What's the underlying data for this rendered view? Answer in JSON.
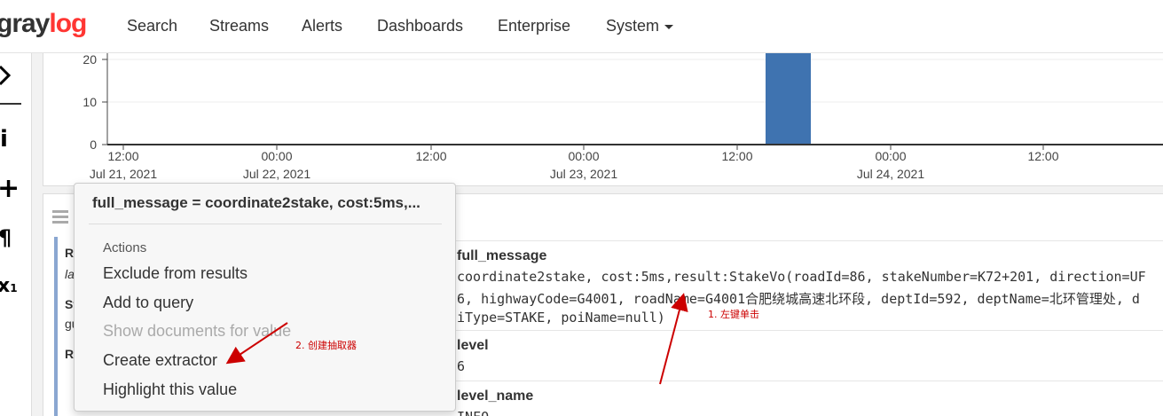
{
  "navbar": {
    "logo_part1": "gray",
    "logo_part2": "log",
    "items": [
      "Search",
      "Streams",
      "Alerts",
      "Dashboards",
      "Enterprise",
      "System"
    ]
  },
  "sidebar": {
    "icons": [
      "chevron-right-icon",
      "info-icon",
      "plus-icon",
      "pilcrow-icon",
      "subscript-x-icon"
    ]
  },
  "histogram": {
    "y_ticks": [
      "20",
      "10",
      "0"
    ],
    "x_ticks": [
      {
        "time": "12:00",
        "date": "Jul 21, 2021"
      },
      {
        "time": "00:00",
        "date": "Jul 22, 2021"
      },
      {
        "time": "12:00",
        "date": ""
      },
      {
        "time": "00:00",
        "date": "Jul 23, 2021"
      },
      {
        "time": "12:00",
        "date": ""
      },
      {
        "time": "00:00",
        "date": "Jul 24, 2021"
      },
      {
        "time": "12:00",
        "date": ""
      }
    ],
    "bar_color": "#3f73b0"
  },
  "chart_data": {
    "type": "bar",
    "categories": [
      "Jul 23, 2021 ~15:00"
    ],
    "values": [
      24
    ],
    "xlabel": "",
    "ylabel": "",
    "ylim": [
      0,
      24
    ]
  },
  "messages": {
    "left_fields": [
      "Re",
      "la",
      "St",
      "gu",
      "Re"
    ],
    "fields": [
      {
        "name": "full_message",
        "lines": [
          "coordinate2stake, cost:5ms,result:StakeVo(roadId=86, stakeNumber=K72+201, direction=UF",
          "6, highwayCode=G4001, roadName=G4001合肥绕城高速北环段, deptId=592, deptName=北环管理处, d",
          "iType=STAKE, poiName=null)"
        ]
      },
      {
        "name": "level",
        "lines": [
          "6"
        ]
      },
      {
        "name": "level_name",
        "lines": [
          "INFO"
        ]
      }
    ]
  },
  "popover": {
    "title": "full_message = coordinate2stake, cost:5ms,...",
    "header": "Actions",
    "items": [
      {
        "label": "Exclude from results",
        "disabled": false
      },
      {
        "label": "Add to query",
        "disabled": false
      },
      {
        "label": "Show documents for value",
        "disabled": true
      },
      {
        "label": "Create extractor",
        "disabled": false
      },
      {
        "label": "Highlight this value",
        "disabled": false
      }
    ]
  },
  "annotations": {
    "step1": "1. 左键单击",
    "step2": "2. 创建抽取器",
    "color": "#cc0000"
  }
}
